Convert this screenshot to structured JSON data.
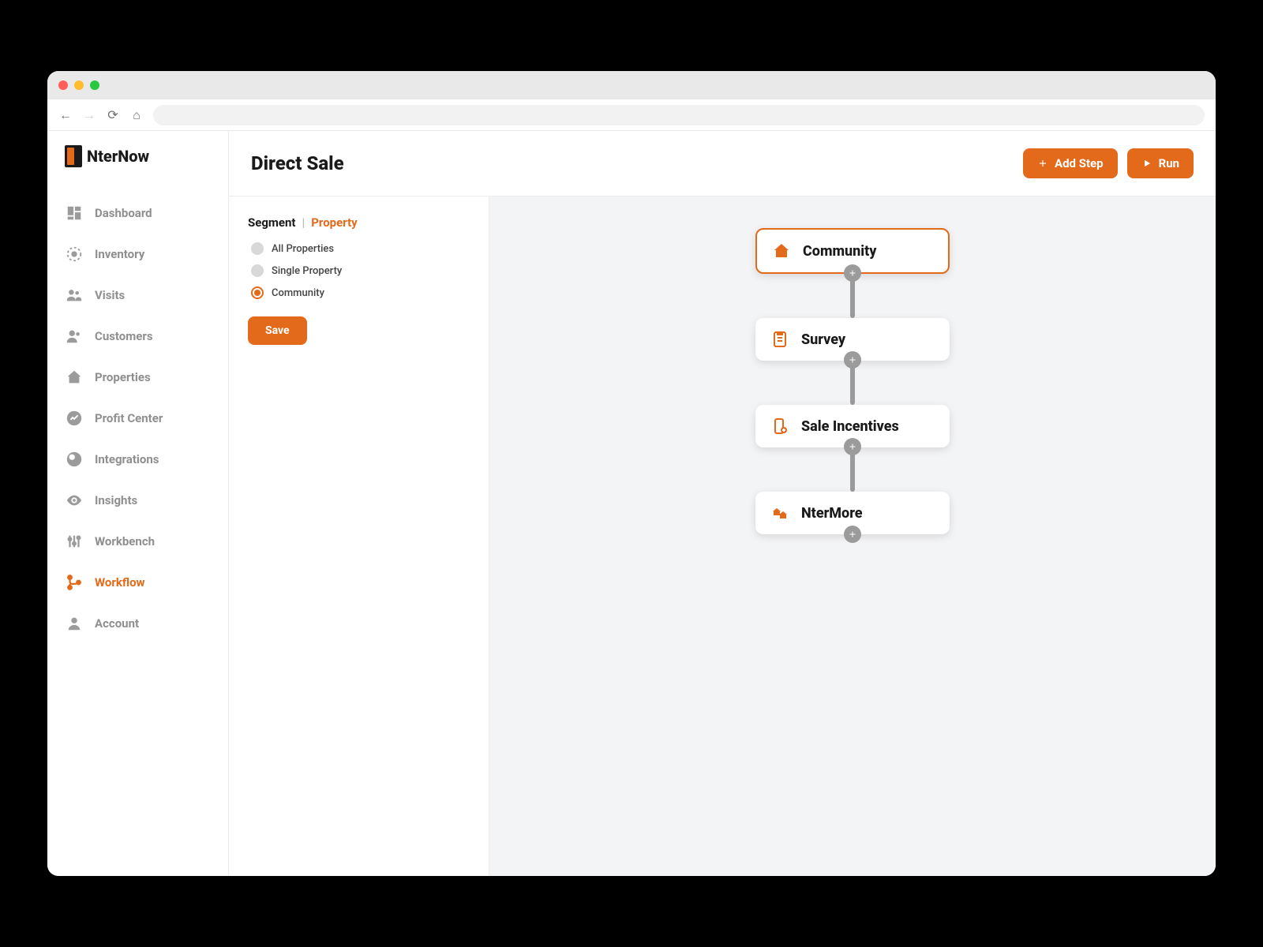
{
  "logo": {
    "text": "NterNow"
  },
  "sidebar": {
    "items": [
      {
        "label": "Dashboard",
        "icon": "dashboard"
      },
      {
        "label": "Inventory",
        "icon": "inventory"
      },
      {
        "label": "Visits",
        "icon": "visits"
      },
      {
        "label": "Customers",
        "icon": "customers"
      },
      {
        "label": "Properties",
        "icon": "properties"
      },
      {
        "label": "Profit Center",
        "icon": "profit"
      },
      {
        "label": "Integrations",
        "icon": "integrations"
      },
      {
        "label": "Insights",
        "icon": "insights"
      },
      {
        "label": "Workbench",
        "icon": "workbench"
      },
      {
        "label": "Workflow",
        "icon": "workflow",
        "active": true
      },
      {
        "label": "Account",
        "icon": "account"
      }
    ]
  },
  "header": {
    "title": "Direct Sale",
    "addStepLabel": "Add Step",
    "runLabel": "Run"
  },
  "config": {
    "segmentLabel": "Segment",
    "segmentDivider": "|",
    "segmentActive": "Property",
    "options": [
      {
        "label": "All Properties",
        "selected": false
      },
      {
        "label": "Single Property",
        "selected": false
      },
      {
        "label": "Community",
        "selected": true
      }
    ],
    "saveLabel": "Save"
  },
  "workflow": {
    "nodes": [
      {
        "label": "Community",
        "icon": "house",
        "active": true
      },
      {
        "label": "Survey",
        "icon": "survey"
      },
      {
        "label": "Sale Incentives",
        "icon": "incentive"
      },
      {
        "label": "NterMore",
        "icon": "ntermore"
      }
    ]
  },
  "colors": {
    "accent": "#e36a1a"
  }
}
